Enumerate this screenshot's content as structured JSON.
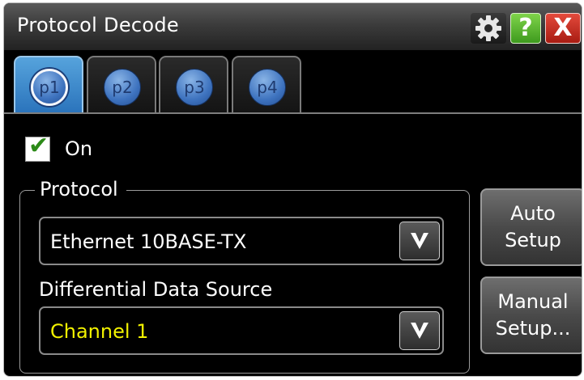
{
  "window": {
    "title": "Protocol Decode",
    "buttons": {
      "settings_icon": "gear-icon",
      "help_label": "?",
      "close_label": "X"
    }
  },
  "tabs": [
    {
      "label": "p1",
      "active": true
    },
    {
      "label": "p2",
      "active": false
    },
    {
      "label": "p3",
      "active": false
    },
    {
      "label": "p4",
      "active": false
    }
  ],
  "on_toggle": {
    "label": "On",
    "checked": true
  },
  "protocol_group": {
    "legend": "Protocol",
    "protocol_select": {
      "value": "Ethernet 10BASE-TX"
    },
    "source_label": "Differential Data Source",
    "source_select": {
      "value": "Channel 1"
    }
  },
  "side_buttons": {
    "auto_setup_line1": "Auto",
    "auto_setup_line2": "Setup",
    "manual_setup_line1": "Manual",
    "manual_setup_line2": "Setup..."
  },
  "colors": {
    "active_tab": "#3b8ad0",
    "channel_1": "#f2f200",
    "help_green": "#5bb832",
    "close_red": "#c8281c"
  }
}
